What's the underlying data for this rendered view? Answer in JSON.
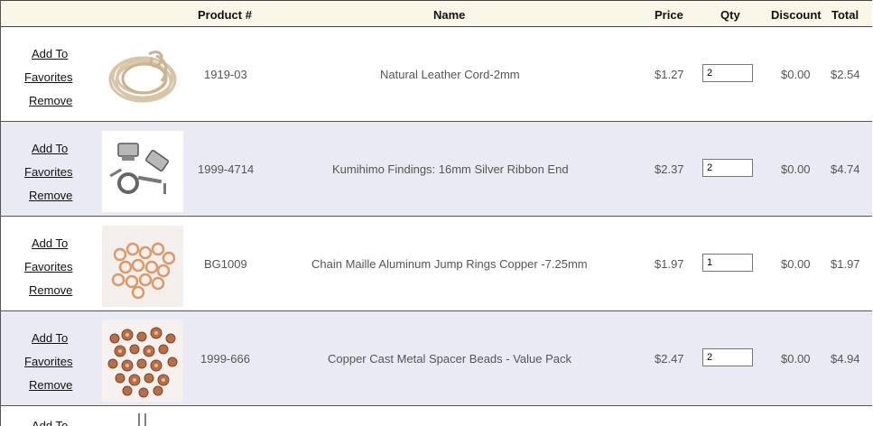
{
  "header": {
    "product_num": "Product #",
    "name": "Name",
    "price": "Price",
    "qty": "Qty",
    "discount": "Discount",
    "total": "Total"
  },
  "actions": {
    "add_to": "Add To",
    "favorites": "Favorites",
    "remove": "Remove"
  },
  "rows": [
    {
      "product_num": "1919-03",
      "name": "Natural Leather Cord-2mm",
      "price": "$1.27",
      "qty": "2",
      "discount": "$0.00",
      "total": "$2.54",
      "image_icon": "leather-cord-image"
    },
    {
      "product_num": "1999-4714",
      "name": "Kumihimo Findings: 16mm Silver Ribbon End",
      "price": "$2.37",
      "qty": "2",
      "discount": "$0.00",
      "total": "$4.74",
      "image_icon": "silver-findings-image"
    },
    {
      "product_num": "BG1009",
      "name": "Chain Maille Aluminum Jump Rings Copper -7.25mm",
      "price": "$1.97",
      "qty": "1",
      "discount": "$0.00",
      "total": "$1.97",
      "image_icon": "copper-jump-rings-image"
    },
    {
      "product_num": "1999-666",
      "name": "Copper Cast Metal Spacer Beads - Value Pack",
      "price": "$2.47",
      "qty": "2",
      "discount": "$0.00",
      "total": "$4.94",
      "image_icon": "copper-spacer-beads-image"
    }
  ],
  "partial_row": {
    "add_to": "Add To"
  }
}
